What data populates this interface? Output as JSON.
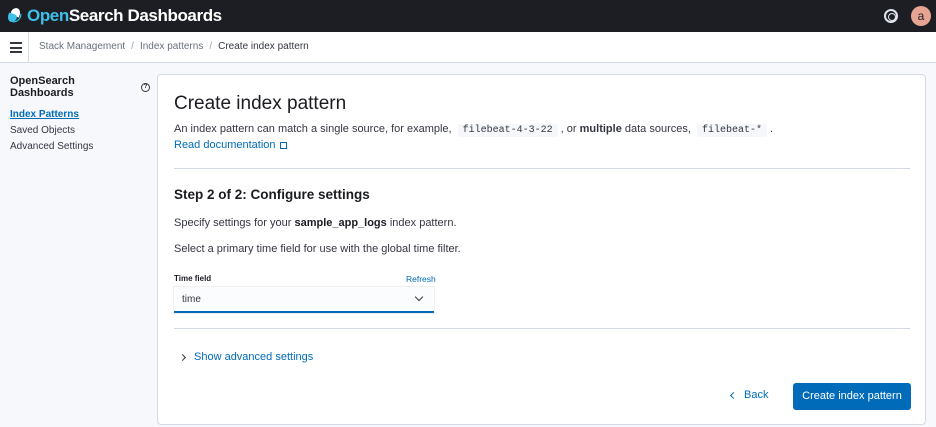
{
  "header": {
    "logo_open": "Open",
    "logo_rest": "Search Dashboards",
    "avatar_initial": "a"
  },
  "breadcrumbs": {
    "items": [
      "Stack Management",
      "Index patterns",
      "Create index pattern"
    ],
    "separator": "/"
  },
  "sidebar": {
    "title": "OpenSearch Dashboards",
    "items": [
      {
        "label": "Index Patterns",
        "active": true
      },
      {
        "label": "Saved Objects",
        "active": false
      },
      {
        "label": "Advanced Settings",
        "active": false
      }
    ]
  },
  "main": {
    "title": "Create index pattern",
    "description": {
      "part1": "An index pattern can match a single source, for example,",
      "code1": "filebeat-4-3-22",
      "part2": ", or",
      "bold": "multiple",
      "part3": "data sources,",
      "code2": "filebeat-*",
      "part4": "."
    },
    "docs_link": "Read documentation",
    "step_title": "Step 2 of 2: Configure settings",
    "spec_prefix": "Specify settings for your",
    "spec_pattern": "sample_app_logs",
    "spec_suffix": "index pattern.",
    "select_hint": "Select a primary time field for use with the global time filter.",
    "time_field": {
      "label": "Time field",
      "refresh": "Refresh",
      "value": "time"
    },
    "advanced_toggle": "Show advanced settings",
    "back_button": "Back",
    "create_button": "Create index pattern"
  },
  "colors": {
    "accent": "#006bb8",
    "header_bg": "#1d1e24",
    "logo_accent": "#3cc0e8",
    "avatar_bg": "#e7a493"
  },
  "icons": [
    "opensearch-logo-icon",
    "help-icon",
    "menu-icon",
    "info-icon",
    "external-link-icon",
    "chevron-down-icon",
    "chevron-right-icon",
    "chevron-left-icon"
  ]
}
